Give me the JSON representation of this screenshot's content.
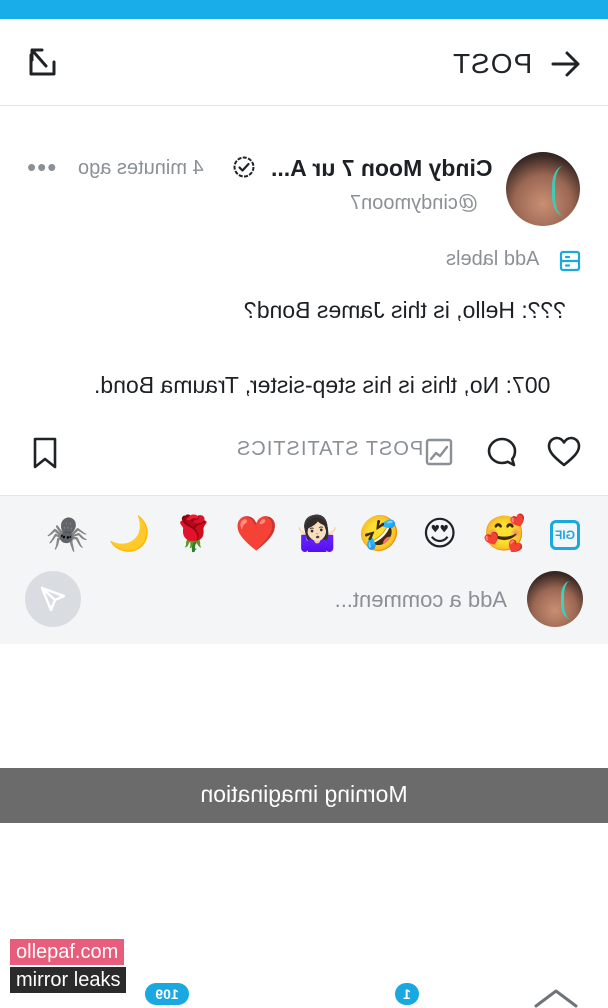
{
  "header": {
    "title": "POST"
  },
  "post": {
    "author_name": "Cindy Moon 7 ur A...",
    "time_ago": "4 minutes ago",
    "more_label": "•••",
    "handle": "@cindymoon7",
    "add_labels": "Add labels",
    "text_line1": "???: Hello, is this James Bond?",
    "text_line2": "007: No, this is his step-sister, Trauma Bond.",
    "stats_label": "POST STATISTICS"
  },
  "comment": {
    "gif_label": "GIF",
    "emojis": [
      "🥰",
      "😍",
      "🤣",
      "🤷🏻‍♀️",
      "❤️",
      "🌹",
      "🌙",
      "🕷️"
    ],
    "placeholder": "Add a comment..."
  },
  "caption": "Morning imagination",
  "watermark": {
    "line1": "ollepaf.com",
    "line2": "mirror leaks"
  },
  "bottom_nav": {
    "badge_left": "109",
    "badge_right": "1"
  },
  "colors": {
    "accent": "#19ade9",
    "muted_text": "#8a9096",
    "caption_bg": "#6b6b6b"
  },
  "icons": [
    "back-arrow-icon",
    "share-out-icon",
    "verified-icon",
    "more-icon",
    "labels-icon",
    "heart-icon",
    "comment-icon",
    "statistics-icon",
    "bookmark-icon",
    "gif-icon",
    "send-icon"
  ]
}
